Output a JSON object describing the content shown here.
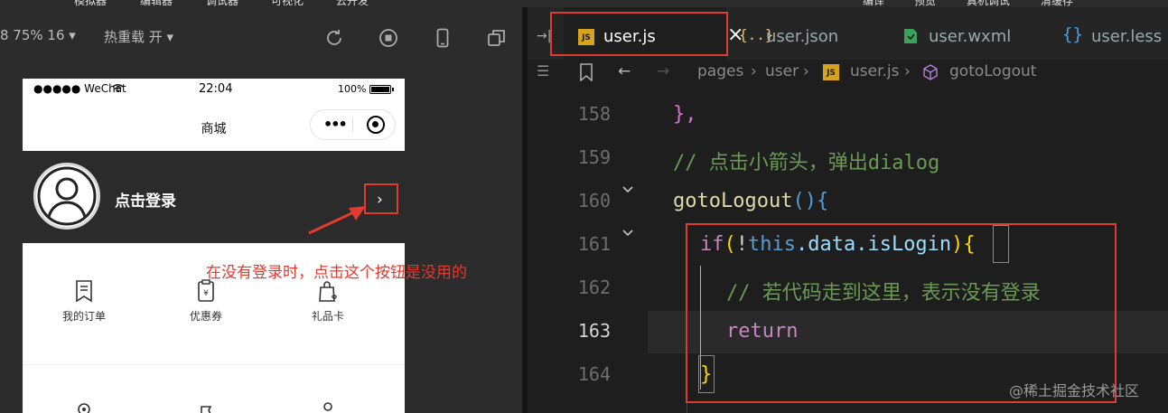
{
  "topmenu": {
    "items": [
      "模拟器",
      "编辑器",
      "调试器",
      "可视化",
      "云开发"
    ],
    "right_items": [
      "编译",
      "预览",
      "真机调试",
      "清缓存"
    ]
  },
  "sim_toolbar": {
    "zoom": "8 75% 16 ▾",
    "hot_reload": "热重载 开 ▾"
  },
  "phone": {
    "carrier": "●●●●● WeChat",
    "time": "22:04",
    "battery_pct": "100%",
    "nav_title": "商城",
    "login_text": "点击登录",
    "chevron": "›",
    "grid": [
      {
        "label": "我的订单",
        "icon": "receipt-icon"
      },
      {
        "label": "优惠券",
        "icon": "coupon-icon"
      },
      {
        "label": "礼品卡",
        "icon": "gift-bag-icon"
      }
    ]
  },
  "annotation": {
    "text": "在没有登录时，点击这个按钮是没用的"
  },
  "tabs": [
    {
      "name": "user.js",
      "icon": "js-icon",
      "active": true
    },
    {
      "name": "user.json",
      "icon": "json-icon",
      "active": false
    },
    {
      "name": "user.wxml",
      "icon": "wxml-icon",
      "active": false
    },
    {
      "name": "user.less",
      "icon": "less-icon",
      "active": false
    }
  ],
  "js_badge": "JS",
  "json_badge": "{..}",
  "less_badge": "{}",
  "breadcrumb": {
    "parts": [
      "pages",
      "user",
      "user.js",
      "gotoLogout"
    ]
  },
  "editor": {
    "current_line": 163,
    "lines": [
      {
        "no": "158"
      },
      {
        "no": "159"
      },
      {
        "no": "160"
      },
      {
        "no": "161"
      },
      {
        "no": "162"
      },
      {
        "no": "163"
      },
      {
        "no": "164"
      }
    ],
    "code": {
      "l158": "},",
      "l159": "// 点击小箭头，弹出dialog",
      "l160_fn": "gotoLogout",
      "l160_paren": "()",
      "l160_brace": "{",
      "l161_if": "if",
      "l161_open": "(",
      "l161_not": "!",
      "l161_this": "this",
      "l161_rest": ".data.isLogin",
      "l161_close": ")",
      "l161_brace": "{",
      "l162": "// 若代码走到这里，表示没有登录",
      "l163": "return",
      "l164": "}"
    }
  },
  "watermark": "@稀土掘金技术社区",
  "colors": {
    "annotation_red": "#e23a2f",
    "comment_green": "#6a9955",
    "keyword_blue": "#569cd6",
    "function_yellow": "#dcdcaa"
  }
}
